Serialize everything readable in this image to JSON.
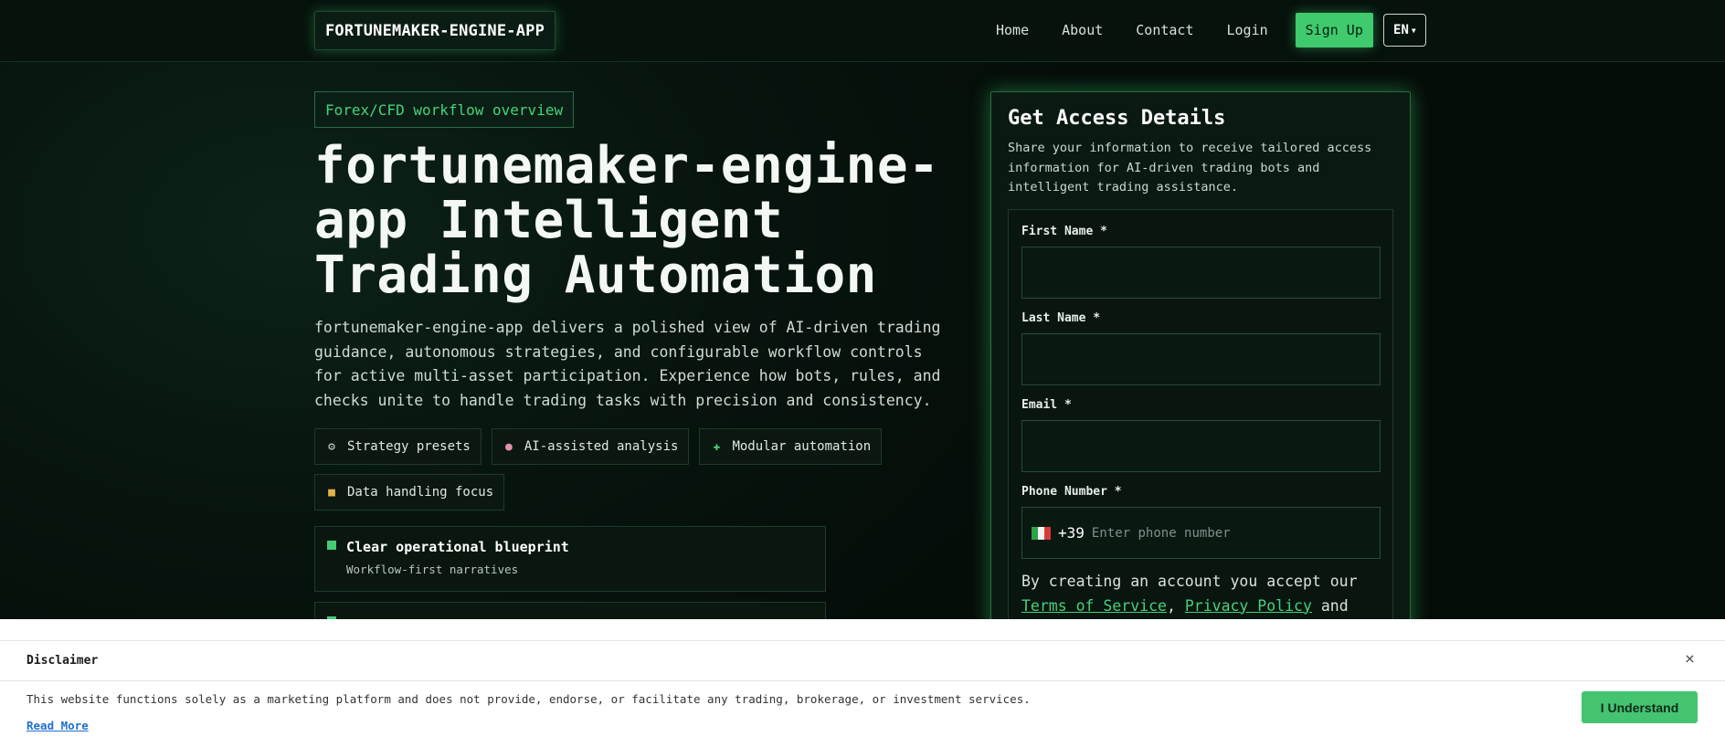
{
  "header": {
    "logo": "FORTUNEMAKER-ENGINE-APP",
    "nav": [
      "Home",
      "About",
      "Contact",
      "Login"
    ],
    "signup": "Sign Up",
    "lang": "EN"
  },
  "hero": {
    "badge": "Forex/CFD workflow overview",
    "title": "fortunemaker-engine-app Intelligent Trading Automation",
    "description": "fortunemaker-engine-app delivers a polished view of AI-driven trading guidance, autonomous strategies, and configurable workflow controls for active multi-asset participation. Experience how bots, rules, and checks unite to handle trading tasks with precision and consistency.",
    "chips": [
      {
        "icon": "gear-icon",
        "label": "Strategy presets"
      },
      {
        "icon": "brain-icon",
        "label": "AI-assisted analysis"
      },
      {
        "icon": "puzzle-icon",
        "label": "Modular automation"
      },
      {
        "icon": "lock-icon",
        "label": "Data handling focus"
      }
    ],
    "features": [
      {
        "title": "Clear operational blueprint",
        "subtitle": "Workflow-first narratives"
      },
      {
        "title": "",
        "subtitle": ""
      }
    ]
  },
  "form": {
    "title": "Get Access Details",
    "subtitle": "Share your information to receive tailored access information for AI-driven trading bots and intelligent trading assistance.",
    "first_name_label": "First Name *",
    "last_name_label": "Last Name *",
    "email_label": "Email *",
    "phone_label": "Phone Number *",
    "dial_code": "+39",
    "phone_placeholder": "Enter phone number",
    "terms_prefix": "By creating an account you accept our ",
    "terms_link": "Terms of Service",
    "terms_sep": ", ",
    "privacy_link": "Privacy Policy",
    "terms_suffix": " and"
  },
  "disclaimer": {
    "title": "Disclaimer",
    "close": "×",
    "text": "This website functions solely as a marketing platform and does not provide, endorse, or facilitate any trading, brokerage, or investment services.",
    "read_more": "Read More",
    "button": "I Understand"
  }
}
